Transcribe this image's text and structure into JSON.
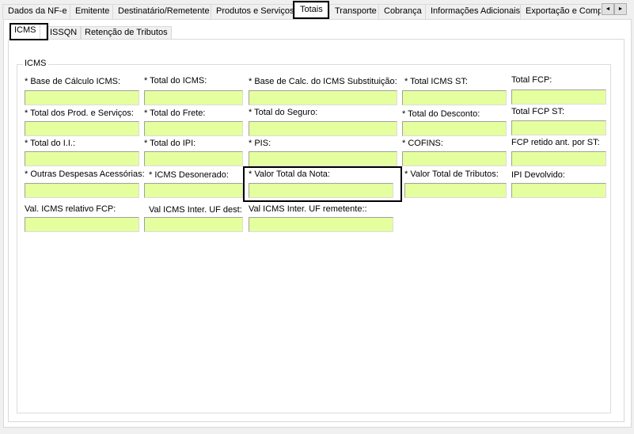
{
  "top_tabs": [
    {
      "label": "Dados da NF-e",
      "active": false
    },
    {
      "label": "Emitente",
      "active": false
    },
    {
      "label": "Destinatário/Remetente",
      "active": false
    },
    {
      "label": "Produtos e Serviços",
      "active": false
    },
    {
      "label": "Totais",
      "active": true
    },
    {
      "label": "Transporte",
      "active": false
    },
    {
      "label": "Cobrança",
      "active": false
    },
    {
      "label": "Informações Adicionais",
      "active": false
    },
    {
      "label": "Exportação e Compra",
      "active": false
    }
  ],
  "scroll": {
    "left": "◄",
    "right": "►"
  },
  "inner_tabs": [
    {
      "label": "ICMS",
      "active": true
    },
    {
      "label": "ISSQN",
      "active": false
    },
    {
      "label": "Retenção de Tributos",
      "active": false
    }
  ],
  "group_title": "ICMS",
  "fields": {
    "base_calculo_icms": {
      "label": "* Base de Cálculo ICMS:",
      "value": ""
    },
    "total_icms": {
      "label": "* Total do ICMS:",
      "value": ""
    },
    "base_calc_icms_st": {
      "label": "* Base de Calc. do ICMS Substituição:",
      "value": ""
    },
    "total_icms_st": {
      "label": "* Total ICMS ST:",
      "value": ""
    },
    "total_fcp": {
      "label": "Total FCP:",
      "value": ""
    },
    "total_prod_servicos": {
      "label": "* Total dos Prod. e Serviços:",
      "value": ""
    },
    "total_frete": {
      "label": "* Total do Frete:",
      "value": ""
    },
    "total_seguro": {
      "label": "* Total do Seguro:",
      "value": ""
    },
    "total_desconto": {
      "label": "* Total do Desconto:",
      "value": ""
    },
    "total_fcp_st": {
      "label": "Total FCP ST:",
      "value": ""
    },
    "total_ii": {
      "label": "* Total do I.I.:",
      "value": ""
    },
    "total_ipi": {
      "label": "* Total do IPI:",
      "value": ""
    },
    "pis": {
      "label": "* PIS:",
      "value": ""
    },
    "cofins": {
      "label": "* COFINS:",
      "value": ""
    },
    "fcp_retido_st": {
      "label": "FCP retido ant. por ST:",
      "value": ""
    },
    "outras_despesas": {
      "label": "* Outras Despesas Acessórias:",
      "value": ""
    },
    "icms_desonerado": {
      "label": "* ICMS Desonerado:",
      "value": ""
    },
    "valor_total_nota": {
      "label": "* Valor Total da Nota:",
      "value": ""
    },
    "valor_total_tributos": {
      "label": "* Valor Total de Tributos:",
      "value": ""
    },
    "ipi_devolvido": {
      "label": "IPI Devolvido:",
      "value": ""
    },
    "val_icms_relativo_fcp": {
      "label": "Val. ICMS relativo FCP:",
      "value": ""
    },
    "val_icms_inter_uf_dest": {
      "label": "Val ICMS Inter. UF dest:",
      "value": ""
    },
    "val_icms_inter_uf_remetente": {
      "label": "Val ICMS Inter. UF remetente::",
      "value": ""
    }
  },
  "colors": {
    "field_bg": "#e5ff9f",
    "panel_bg": "#ffffff",
    "window_bg": "#f0f0f0"
  }
}
